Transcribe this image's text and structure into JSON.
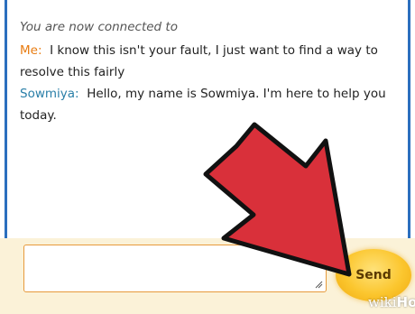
{
  "chat": {
    "status": "You are now connected to",
    "messages": [
      {
        "sender": "Me:",
        "text": "I know this isn't your fault, I just want to find a way to resolve this fairly"
      },
      {
        "sender": "Sowmiya:",
        "text": "Hello, my name is Sowmiya. I'm here to help you today."
      }
    ]
  },
  "composer": {
    "input_value": "",
    "send_label": "Send"
  },
  "watermark": {
    "prefix": "wiki",
    "suffix": "How"
  },
  "colors": {
    "border": "#2b6fbe",
    "me_sender": "#e87c12",
    "agent_sender": "#2a7fa8",
    "arrow": "#d9303a",
    "send_button": "#fbc62e"
  },
  "icons": [
    "resize-grip-icon",
    "red-arrow-icon"
  ]
}
